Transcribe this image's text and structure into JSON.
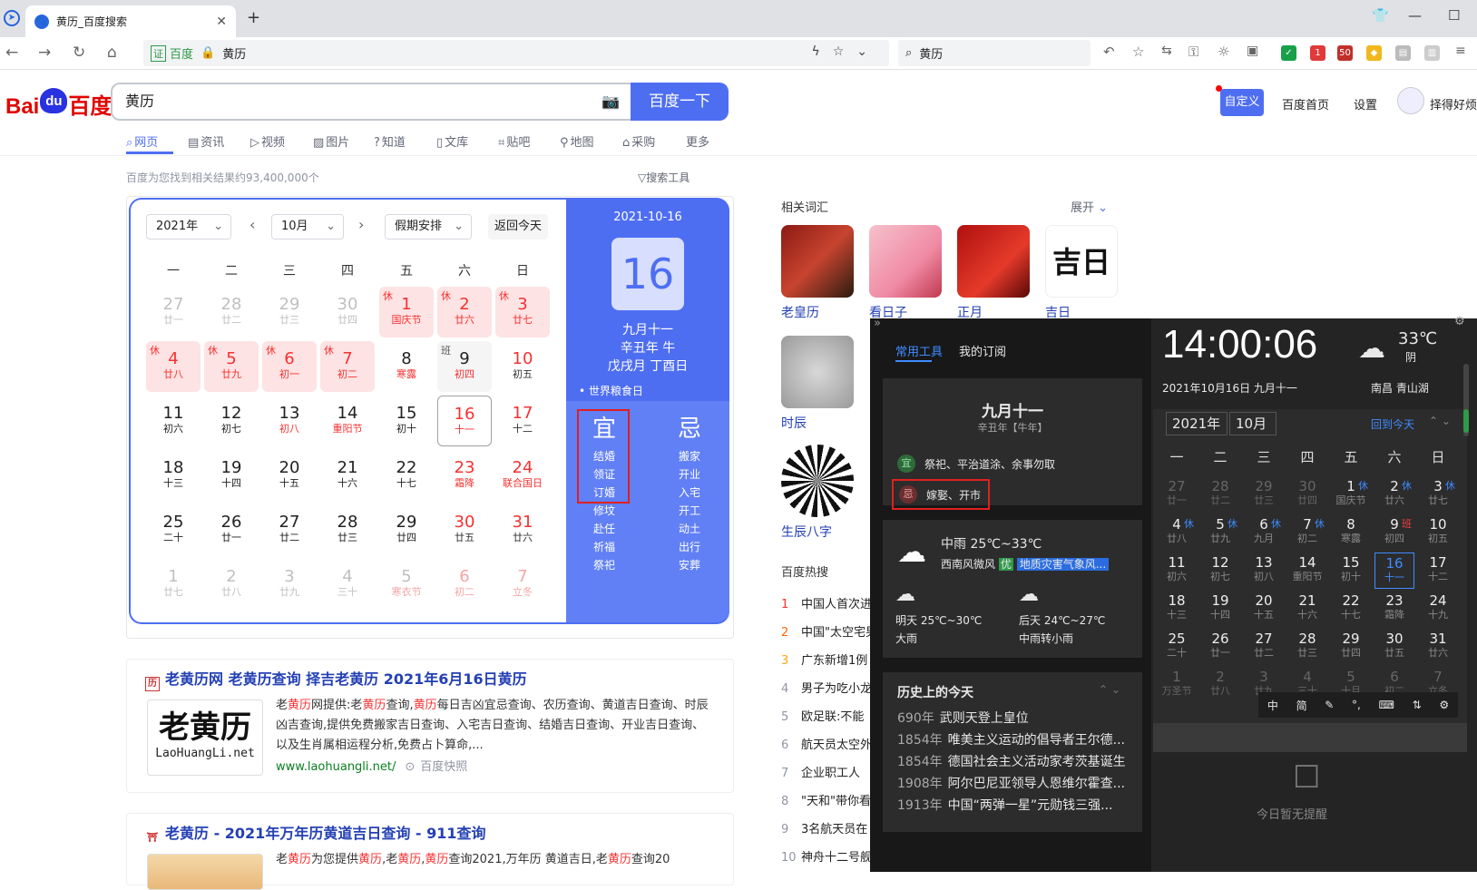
{
  "browser": {
    "tab_title": "黄历_百度搜索",
    "address_engine": "百度",
    "address_text": "黄历",
    "search_text": "黄历",
    "ext_badges": [
      "1",
      "50"
    ]
  },
  "baidu": {
    "logo_left": "Bai",
    "logo_mid": "du",
    "logo_right": "百度",
    "query": "黄历",
    "search_button": "百度一下",
    "customize": "自定义",
    "home": "百度首页",
    "settings": "设置",
    "username": "择得好烦",
    "tabs": [
      "网页",
      "资讯",
      "视频",
      "图片",
      "知道",
      "文库",
      "贴吧",
      "地图",
      "采购",
      "更多"
    ],
    "result_count": "百度为您找到相关结果约93,400,000个",
    "search_tools": "搜索工具"
  },
  "calendar": {
    "year": "2021年",
    "month": "10月",
    "holiday": "假期安排",
    "back_today": "返回今天",
    "weekdays": [
      "一",
      "二",
      "三",
      "四",
      "五",
      "六",
      "日"
    ],
    "weeks": [
      [
        [
          "27",
          "廿一",
          "g"
        ],
        [
          "28",
          "廿二",
          "g"
        ],
        [
          "29",
          "廿三",
          "g"
        ],
        [
          "30",
          "廿四",
          "g"
        ],
        [
          "1",
          "国庆节",
          "rest",
          "休"
        ],
        [
          "2",
          "廿六",
          "rest",
          "休"
        ],
        [
          "3",
          "廿七",
          "rest",
          "休"
        ]
      ],
      [
        [
          "4",
          "廿八",
          "rest",
          "休"
        ],
        [
          "5",
          "廿九",
          "rest",
          "休"
        ],
        [
          "6",
          "初一",
          "rest",
          "休"
        ],
        [
          "7",
          "初二",
          "rest",
          "休"
        ],
        [
          "8",
          "寒露",
          "lr"
        ],
        [
          "9",
          "初四",
          "work",
          "班"
        ],
        [
          "10",
          "初五",
          "red"
        ]
      ],
      [
        [
          "11",
          "初六",
          ""
        ],
        [
          "12",
          "初七",
          ""
        ],
        [
          "13",
          "初八",
          "lr"
        ],
        [
          "14",
          "重阳节",
          "lr"
        ],
        [
          "15",
          "初十",
          ""
        ],
        [
          "16",
          "十一",
          "cur"
        ],
        [
          "17",
          "十二",
          "red"
        ]
      ],
      [
        [
          "18",
          "十三",
          ""
        ],
        [
          "19",
          "十四",
          ""
        ],
        [
          "20",
          "十五",
          ""
        ],
        [
          "21",
          "十六",
          ""
        ],
        [
          "22",
          "十七",
          ""
        ],
        [
          "23",
          "霜降",
          "redall"
        ],
        [
          "24",
          "联合国日",
          "redall"
        ]
      ],
      [
        [
          "25",
          "二十",
          ""
        ],
        [
          "26",
          "廿一",
          ""
        ],
        [
          "27",
          "廿二",
          ""
        ],
        [
          "28",
          "廿三",
          ""
        ],
        [
          "29",
          "廿四",
          ""
        ],
        [
          "30",
          "廿五",
          "red"
        ],
        [
          "31",
          "廿六",
          "red"
        ]
      ],
      [
        [
          "1",
          "廿七",
          "g"
        ],
        [
          "2",
          "廿八",
          "g"
        ],
        [
          "3",
          "廿九",
          "g"
        ],
        [
          "4",
          "三十",
          "g"
        ],
        [
          "5",
          "寒衣节",
          "gl"
        ],
        [
          "6",
          "初二",
          "gr"
        ],
        [
          "7",
          "立冬",
          "gr"
        ]
      ]
    ],
    "right": {
      "date": "2021-10-16",
      "day": "16",
      "lunar": "九月十一",
      "ganzhi_year": "辛丑年 牛",
      "ganzhi_month": "戊戌月 丁酉日",
      "festival": "• 世界粮食日",
      "yi_label": "宜",
      "ji_label": "忌",
      "yi": [
        "结婚",
        "领证",
        "订婚",
        "修坟",
        "赴任",
        "祈福",
        "祭祀"
      ],
      "ji": [
        "搬家",
        "开业",
        "入宅",
        "开工",
        "动土",
        "出行",
        "安葬"
      ]
    }
  },
  "related": {
    "heading": "相关词汇",
    "expand": "展开",
    "items": [
      "老皇历",
      "看日子",
      "正月",
      "吉日",
      "时辰",
      "生辰八字"
    ]
  },
  "hot": {
    "heading": "百度热搜",
    "items": [
      "中国人首次进",
      "中国\"太空宅男",
      "广东新增1例",
      "男子为吃小龙",
      "欧足联:不能",
      "航天员太空外",
      "企业职工人",
      "\"天和\"带你看",
      "3名航天员在",
      "神舟十二号舰"
    ]
  },
  "results": [
    {
      "title": "老黄历网 老黄历查询 择吉老黄历 2021年6月16日黄历",
      "snippet": "老黄历网提供:老黄历查询,黄历每日吉凶宜忌查询、农历查询、黄道吉日查询、时辰凶吉查询,提供免费搬家吉日查询、入宅吉日查询、结婚吉日查询、开业吉日查询、以及生肖属相运程分析,免费占卜算命,...",
      "url": "www.laohuangli.net/",
      "cache": "百度快照",
      "thumb_text": "老黄历",
      "thumb_sub": "LaoHuangLi.net"
    },
    {
      "title": "老黄历 - 2021年万年历黄道吉日查询 - 911查询",
      "snippet": "老黄历为您提供黄历,老黄历,黄历查询2021,万年历 黄道吉日,老黄历查询20"
    }
  ],
  "overlay": {
    "tab_tools": "常用工具",
    "tab_sub": "我的订阅",
    "lunar": "九月十一",
    "ganzhi": "辛丑年【牛年】",
    "yi_mark": "宜",
    "yi_text": "祭祀、平治道涂、余事勿取",
    "ji_mark": "忌",
    "ji_text": "嫁娶、开市",
    "weather_main": "中雨  25℃~33℃",
    "wind": "西南风微风",
    "aqi": "优",
    "alert": "地质灾害气象风...",
    "tomorrow": "明天 25℃~30℃",
    "tomorrow_cond": "大雨",
    "after": "后天 24℃~27℃",
    "after_cond": "中雨转小雨",
    "history_heading": "历史上的今天",
    "history": [
      [
        "690年",
        "武则天登上皇位"
      ],
      [
        "1854年",
        "唯美主义运动的倡导者王尔德..."
      ],
      [
        "1854年",
        "德国社会主义活动家考茨基诞生"
      ],
      [
        "1908年",
        "阿尔巴尼亚领导人恩维尔霍查..."
      ],
      [
        "1913年",
        "中国“两弹一星”元勋钱三强..."
      ]
    ],
    "time": "14:00:06",
    "date_line": "2021年10月16日 九月十一",
    "temp": "33℃",
    "cond": "阴",
    "place": "南昌 青山湖",
    "cal_year": "2021年",
    "cal_month": "10月",
    "back_today": "回到今天",
    "weekdays": [
      "一",
      "二",
      "三",
      "四",
      "五",
      "六",
      "日"
    ],
    "weeks": [
      [
        [
          "27",
          "廿一",
          "g"
        ],
        [
          "28",
          "廿二",
          "g"
        ],
        [
          "29",
          "廿三",
          "g"
        ],
        [
          "30",
          "廿四",
          "g"
        ],
        [
          "1",
          "国庆节",
          "",
          "休"
        ],
        [
          "2",
          "廿六",
          "",
          "休"
        ],
        [
          "3",
          "廿七",
          "",
          "休"
        ]
      ],
      [
        [
          "4",
          "廿八",
          "",
          "休"
        ],
        [
          "5",
          "廿九",
          "",
          "休"
        ],
        [
          "6",
          "九月",
          "",
          "休"
        ],
        [
          "7",
          "初二",
          "",
          "休"
        ],
        [
          "8",
          "寒露",
          ""
        ],
        [
          "9",
          "初四",
          "",
          "班"
        ],
        [
          "10",
          "初五",
          ""
        ]
      ],
      [
        [
          "11",
          "初六",
          ""
        ],
        [
          "12",
          "初七",
          ""
        ],
        [
          "13",
          "初八",
          ""
        ],
        [
          "14",
          "重阳节",
          ""
        ],
        [
          "15",
          "初十",
          ""
        ],
        [
          "16",
          "十一",
          "cur"
        ],
        [
          "17",
          "十二",
          ""
        ]
      ],
      [
        [
          "18",
          "十三",
          ""
        ],
        [
          "19",
          "十四",
          ""
        ],
        [
          "20",
          "十五",
          ""
        ],
        [
          "21",
          "十六",
          ""
        ],
        [
          "22",
          "十七",
          ""
        ],
        [
          "23",
          "霜降",
          ""
        ],
        [
          "24",
          "十九",
          ""
        ]
      ],
      [
        [
          "25",
          "二十",
          ""
        ],
        [
          "26",
          "廿一",
          ""
        ],
        [
          "27",
          "廿二",
          ""
        ],
        [
          "28",
          "廿三",
          ""
        ],
        [
          "29",
          "廿四",
          ""
        ],
        [
          "30",
          "廿五",
          ""
        ],
        [
          "31",
          "廿六",
          ""
        ]
      ],
      [
        [
          "1",
          "万圣节",
          "g"
        ],
        [
          "2",
          "廿八",
          "g"
        ],
        [
          "3",
          "廿九",
          "g"
        ],
        [
          "4",
          "三十",
          "g"
        ],
        [
          "5",
          "十月",
          "g"
        ],
        [
          "6",
          "初二",
          "g"
        ],
        [
          "7",
          "立冬",
          "g"
        ]
      ]
    ],
    "ime": [
      "中",
      "简"
    ],
    "no_reminder": "今日暂无提醒"
  }
}
